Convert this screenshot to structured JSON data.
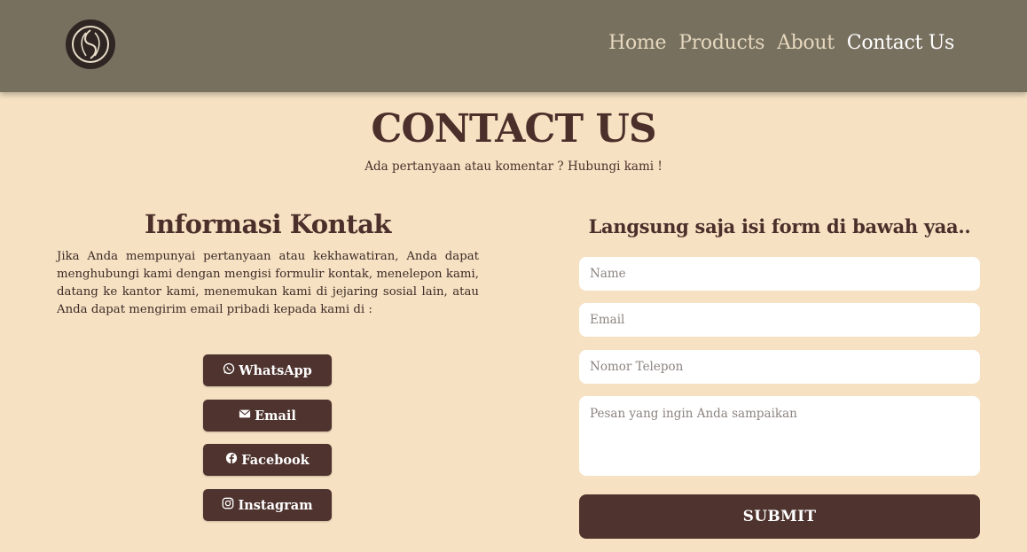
{
  "nav": {
    "links": [
      "Home",
      "Products",
      "About",
      "Contact Us"
    ],
    "active": "Contact Us"
  },
  "header": {
    "title": "CONTACT US",
    "subtitle": "Ada pertanyaan atau komentar ? Hubungi kami !"
  },
  "info": {
    "title": "Informasi Kontak",
    "text": "Jika Anda mempunyai pertanyaan atau kekhawatiran, Anda dapat menghubungi kami dengan mengisi formulir kontak, menelepon kami, datang ke kantor kami, menemukan kami di jejaring sosial lain, atau Anda dapat mengirim email pribadi kepada kami di :",
    "buttons": [
      {
        "label": "WhatsApp",
        "icon": "whatsapp-icon"
      },
      {
        "label": "Email",
        "icon": "envelope-icon"
      },
      {
        "label": "Facebook",
        "icon": "facebook-icon"
      },
      {
        "label": "Instagram",
        "icon": "instagram-icon"
      }
    ]
  },
  "form": {
    "title": "Langsung saja isi form di bawah yaa..",
    "name_placeholder": "Name",
    "email_placeholder": "Email",
    "phone_placeholder": "Nomor Telepon",
    "message_placeholder": "Pesan yang ingin Anda sampaikan",
    "submit_label": "SUBMIT"
  },
  "colors": {
    "navbar": "#78705f",
    "background": "#f6e2c3",
    "accent": "#4e332e"
  }
}
